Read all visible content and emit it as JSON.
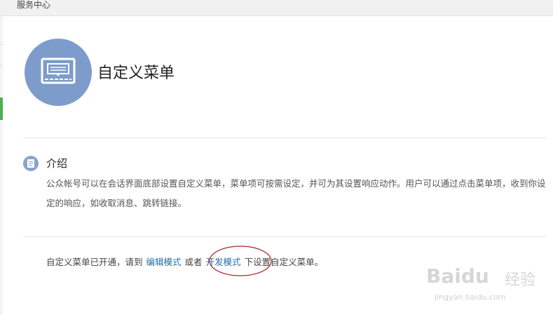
{
  "header": {
    "title": "服务中心"
  },
  "feature": {
    "title": "自定义菜单",
    "icon": "monitor-chat-icon"
  },
  "intro": {
    "heading": "介绍",
    "icon": "document-icon",
    "body": "公众帐号可以在会话界面底部设置自定义菜单，菜单项可按需设定，并可为其设置响应动作。用户可以通过点击菜单项，收到你设定的响应，如收取消息、跳转链接。"
  },
  "status": {
    "prefix": "自定义菜单已开通，请到",
    "edit_mode_link": "编辑模式",
    "or_text": "或者",
    "dev_mode_link": "开发模式",
    "suffix": "下设置自定义菜单。"
  },
  "watermark": {
    "logo": "Baidu",
    "logo_suffix": "经验",
    "url": "jingyan.baidu.com"
  },
  "colors": {
    "icon_bg": "#7e9ccb",
    "link": "#2a6fa8",
    "annotation": "#a52a2a"
  }
}
